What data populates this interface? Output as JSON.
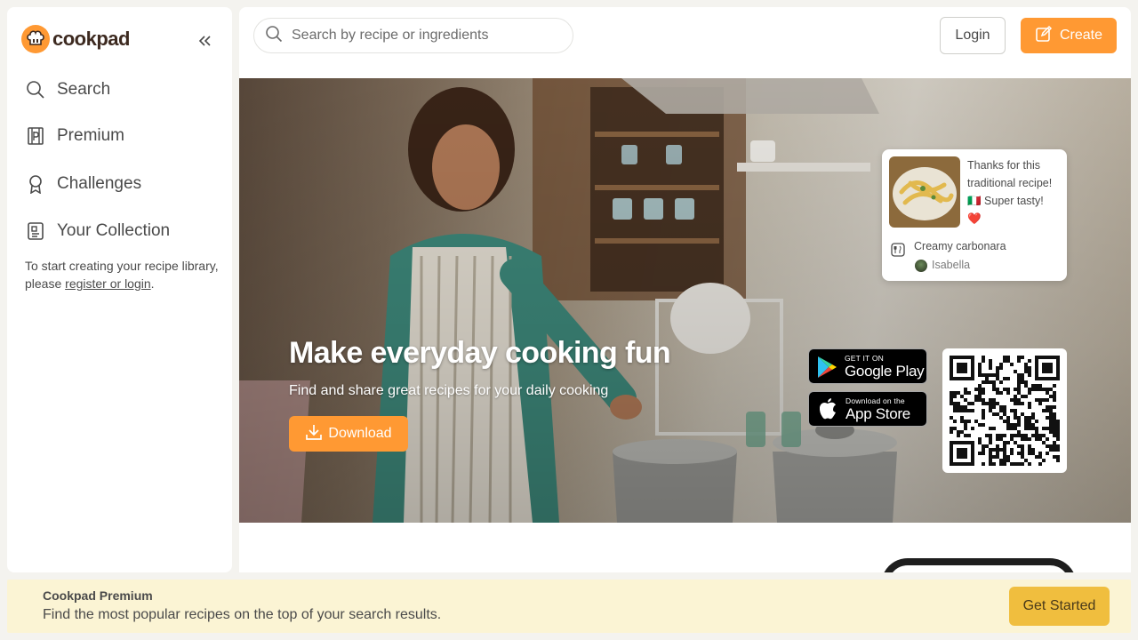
{
  "brand": {
    "name": "cookpad",
    "accent": "#ff9933"
  },
  "sidebar": {
    "items": [
      {
        "label": "Search",
        "icon": "search-icon"
      },
      {
        "label": "Premium",
        "icon": "premium-icon"
      },
      {
        "label": "Challenges",
        "icon": "challenge-badge-icon"
      },
      {
        "label": "Your Collection",
        "icon": "collection-icon"
      }
    ],
    "collection_note_prefix": "To start creating your recipe library, please ",
    "collection_note_link": "register or login",
    "collection_note_suffix": "."
  },
  "header": {
    "search_placeholder": "Search by recipe or ingredients",
    "login_label": "Login",
    "create_label": "Create"
  },
  "hero": {
    "title": "Make everyday cooking fun",
    "subtitle": "Find and share great recipes for your daily cooking",
    "download_label": "Download"
  },
  "review": {
    "text": "Thanks for this traditional recipe! 🇮🇹 Super tasty! ❤️",
    "recipe": "Creamy carbonara",
    "author": "Isabella"
  },
  "badges": {
    "google_small": "GET IT ON",
    "google_big": "Google Play",
    "apple_small": "Download on the",
    "apple_big": "App Store"
  },
  "premium_banner": {
    "title": "Cookpad Premium",
    "description": "Find the most popular recipes on the top of your search results.",
    "button_label": "Get Started",
    "background": "#fbf4d4",
    "button_color": "#f0be3e"
  }
}
